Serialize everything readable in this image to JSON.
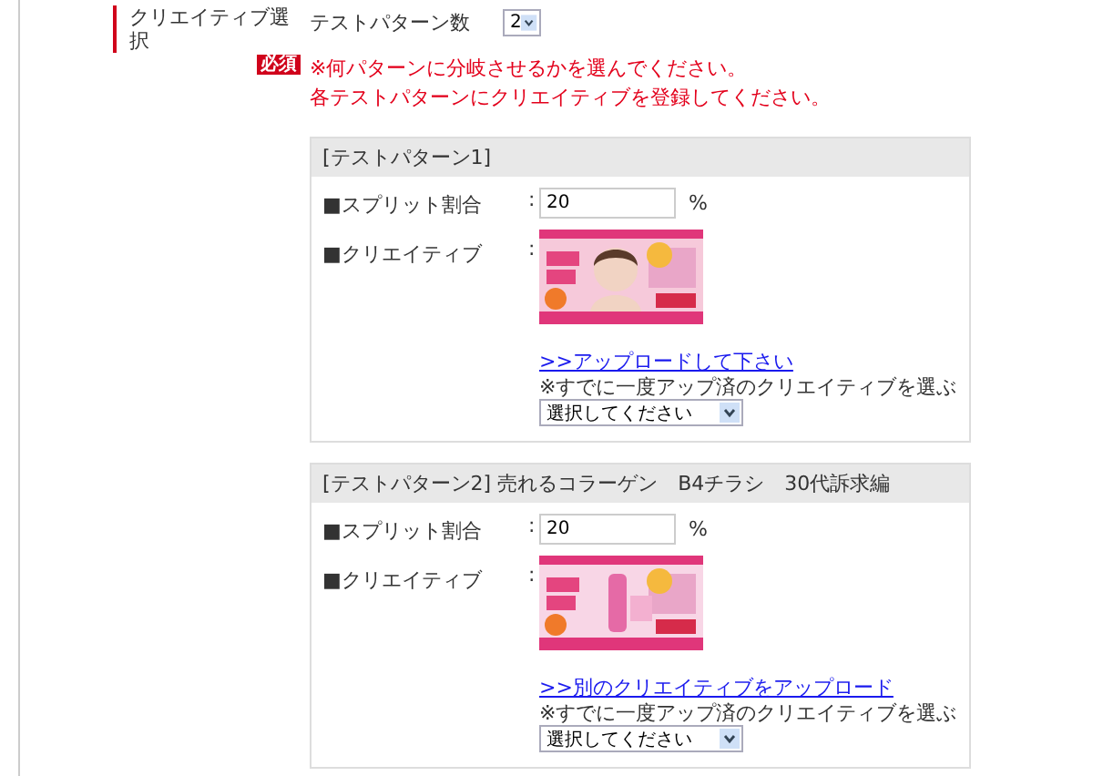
{
  "section": {
    "label": "クリエイティブ選択",
    "badge": "必須"
  },
  "pattern_count": {
    "label": "テストパターン数",
    "value": "2"
  },
  "notes": [
    "※何パターンに分岐させるかを選んでください。",
    "各テストパターンにクリエイティブを登録してください。"
  ],
  "patterns": [
    {
      "title": "[テストパターン1]",
      "split_label": "■スプリット割合",
      "split_colon": ":",
      "split_value": "20",
      "split_unit": "%",
      "creative_label": "■クリエイティブ",
      "creative_colon": ":",
      "link": ">>アップロードして下さい",
      "hint": "※すでに一度アップ済のクリエイティブを選ぶ",
      "select": "選択してください"
    },
    {
      "title": "[テストパターン2] 売れるコラーゲン　B4チラシ　30代訴求編",
      "split_label": "■スプリット割合",
      "split_colon": ":",
      "split_value": "20",
      "split_unit": "%",
      "creative_label": "■クリエイティブ",
      "creative_colon": ":",
      "link": ">>別のクリエイティブをアップロード",
      "hint": "※すでに一度アップ済のクリエイティブを選ぶ",
      "select": "選択してください"
    }
  ]
}
